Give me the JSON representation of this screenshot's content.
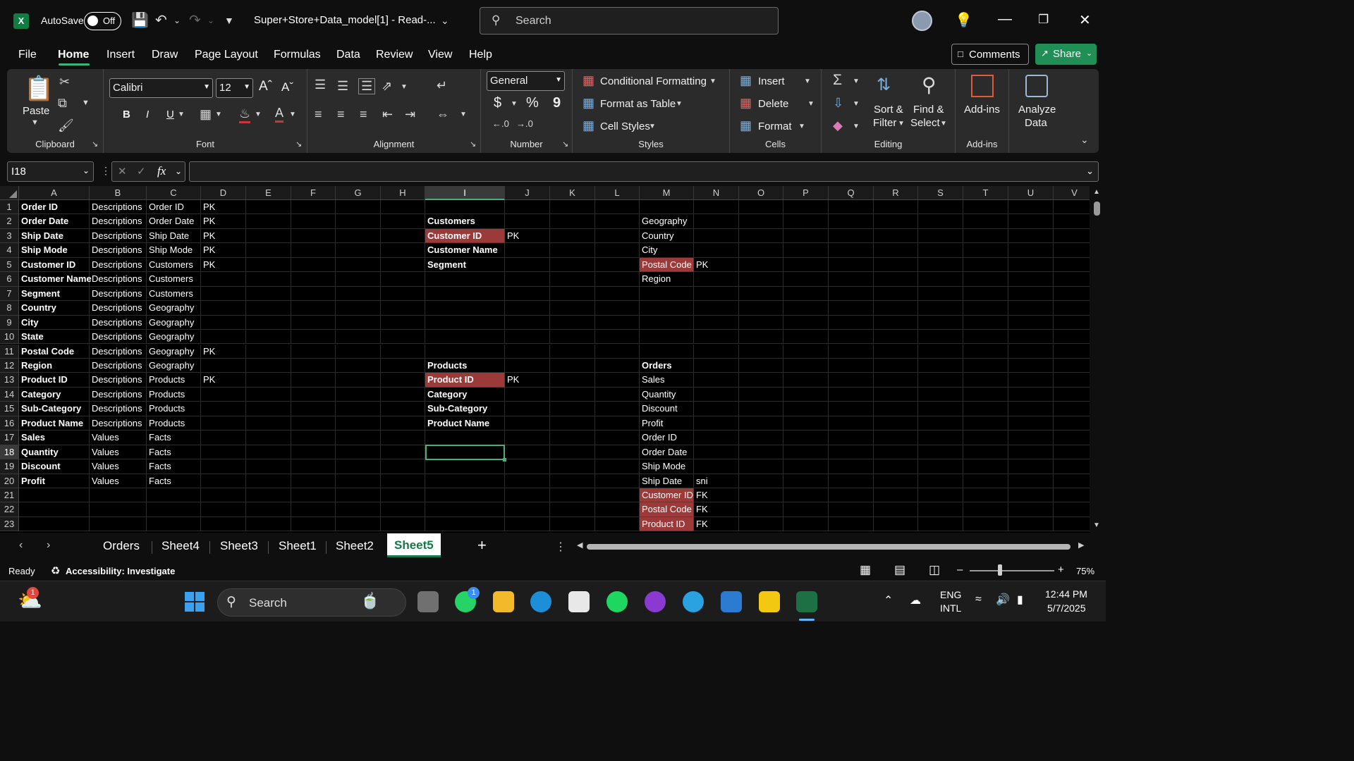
{
  "titlebar": {
    "app_letter": "X",
    "autosave_label": "AutoSave",
    "autosave_state": "Off",
    "doc_title": "Super+Store+Data_model[1]  -  Read-...",
    "search_placeholder": "Search"
  },
  "menu": {
    "items": [
      "File",
      "Home",
      "Insert",
      "Draw",
      "Page Layout",
      "Formulas",
      "Data",
      "Review",
      "View",
      "Help"
    ],
    "active": "Home",
    "comments_label": "Comments",
    "share_label": "Share"
  },
  "ribbon": {
    "clipboard": {
      "paste": "Paste",
      "label": "Clipboard"
    },
    "font": {
      "name": "Calibri",
      "size": "12",
      "bold": "B",
      "italic": "I",
      "underline": "U",
      "label": "Font"
    },
    "alignment": {
      "label": "Alignment"
    },
    "number": {
      "format": "General",
      "currency": "$",
      "percent": "%",
      "comma": "9",
      "label": "Number"
    },
    "styles": {
      "conditional": "Conditional Formatting",
      "format_table": "Format as Table",
      "cell_styles": "Cell Styles",
      "label": "Styles"
    },
    "cells": {
      "insert": "Insert",
      "delete": "Delete",
      "format": "Format",
      "label": "Cells"
    },
    "editing": {
      "sort_filter_1": "Sort &",
      "sort_filter_2": "Filter",
      "find_select_1": "Find &",
      "find_select_2": "Select",
      "label": "Editing"
    },
    "addins": {
      "btn": "Add-ins",
      "label": "Add-ins"
    },
    "analyze": {
      "line1": "Analyze",
      "line2": "Data"
    }
  },
  "formula_bar": {
    "name_box": "I18",
    "fx": "fx",
    "content": ""
  },
  "sheet": {
    "columns": [
      "A",
      "B",
      "C",
      "D",
      "E",
      "F",
      "G",
      "H",
      "I",
      "J",
      "K",
      "L",
      "M",
      "N",
      "O",
      "P",
      "Q",
      "R",
      "S",
      "T",
      "U",
      "V"
    ],
    "rows": [
      "1",
      "2",
      "3",
      "4",
      "5",
      "6",
      "7",
      "8",
      "9",
      "10",
      "11",
      "12",
      "13",
      "14",
      "15",
      "16",
      "17",
      "18",
      "19",
      "20",
      "21",
      "22",
      "23"
    ],
    "selected_column": "I",
    "selected_row": "18",
    "col_a": [
      "Order ID",
      "Order Date",
      "Ship Date",
      "Ship Mode",
      "Customer ID",
      "Customer Name",
      "Segment",
      "Country",
      "City",
      "State",
      "Postal Code",
      "Region",
      "Product ID",
      "Category",
      "Sub-Category",
      "Product Name",
      "Sales",
      "Quantity",
      "Discount",
      "Profit"
    ],
    "col_b": [
      "Descriptions",
      "Descriptions",
      "Descriptions",
      "Descriptions",
      "Descriptions",
      "Descriptions",
      "Descriptions",
      "Descriptions",
      "Descriptions",
      "Descriptions",
      "Descriptions",
      "Descriptions",
      "Descriptions",
      "Descriptions",
      "Descriptions",
      "Descriptions",
      "Values",
      "Values",
      "Values",
      "Values"
    ],
    "col_c": [
      "Order ID",
      "Order Date",
      "Ship Date",
      "Ship Mode",
      "Customers",
      "Customers",
      "Customers",
      "Geography",
      "Geography",
      "Geography",
      "Geography",
      "Geography",
      "Products",
      "Products",
      "Products",
      "Products",
      "Facts",
      "Facts",
      "Facts",
      "Facts"
    ],
    "col_d": [
      "PK",
      "PK",
      "PK",
      "PK",
      "PK",
      "",
      "",
      "",
      "",
      "",
      "PK",
      "",
      "PK",
      "",
      "",
      "",
      "",
      "",
      "",
      ""
    ],
    "col_i": {
      "r2": "Customers",
      "r3": "Customer ID",
      "r4": "Customer Name",
      "r5": "Segment",
      "r12": "Products",
      "r13": "Product ID",
      "r14": "Category",
      "r15": "Sub-Category",
      "r16": "Product  Name"
    },
    "col_j": {
      "r3": "PK",
      "r13": "PK"
    },
    "col_m": {
      "r2": "Geography",
      "r3": "Country",
      "r4": "City",
      "r5": "Postal Code",
      "r6": "Region",
      "r12": "Orders",
      "r13": "Sales",
      "r14": "Quantity",
      "r15": "Discount",
      "r16": "Profit",
      "r17": "Order ID",
      "r18": "Order Date",
      "r19": "Ship Mode",
      "r20": "Ship Date",
      "r21": "Customer ID",
      "r22": "Postal Code",
      "r23": "Product ID"
    },
    "col_n": {
      "r5": "PK",
      "r20": "sni",
      "r21": "FK",
      "r22": "FK",
      "r23": "FK"
    },
    "highlight_color": "#9b3a38"
  },
  "tabs": {
    "sheets": [
      "Orders",
      "Sheet4",
      "Sheet3",
      "Sheet1",
      "Sheet2",
      "Sheet5"
    ],
    "active": "Sheet5",
    "add": "+"
  },
  "status": {
    "ready": "Ready",
    "accessibility": "Accessibility: Investigate",
    "zoom": "75%"
  },
  "taskbar": {
    "search": "Search",
    "weather_badge": "1",
    "whatsapp_badge": "1",
    "lang1": "ENG",
    "lang2": "INTL",
    "time": "12:44 PM",
    "date": "5/7/2025"
  }
}
